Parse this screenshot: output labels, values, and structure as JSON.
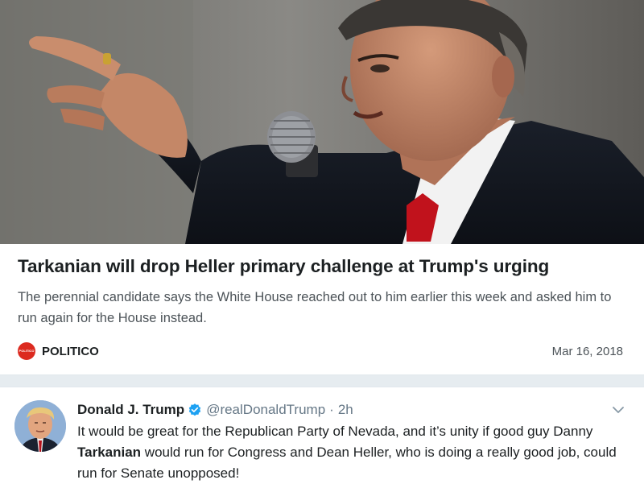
{
  "article": {
    "photo_alt": "photo",
    "headline": "Tarkanian will drop Heller primary challenge at Trump's urging",
    "summary": "The perennial candidate says the White House reached out to him earlier this week and asked him to run again for the House instead.",
    "source_logo_text": "POLITICO",
    "source_name": "POLITICO",
    "date": "Mar 16, 2018"
  },
  "tweet": {
    "display_name": "Donald J. Trump",
    "handle": "@realDonaldTrump",
    "separator": "·",
    "time": "2h",
    "text_part1": "It would be great for the Republican Party of Nevada, and it’s unity if good guy Danny ",
    "text_bold": "Tarkanian",
    "text_part2": " would run for Congress and Dean Heller, who is doing a really good job, could run for Senate unopposed!"
  },
  "icons": {
    "verified": "verified-badge-icon",
    "caret": "chevron-down-icon"
  },
  "colors": {
    "politico_red": "#dc2a1f",
    "verified_blue": "#1da1f2",
    "text_primary": "#1c2022",
    "text_secondary": "#657786",
    "background": "#e6ecf0"
  }
}
